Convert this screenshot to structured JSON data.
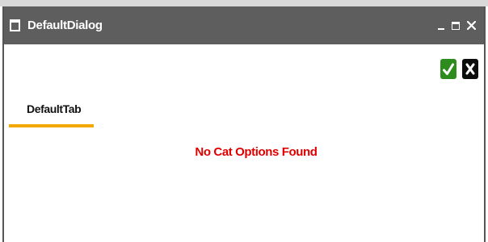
{
  "window": {
    "title": "DefaultDialog",
    "icons": {
      "window": "window-icon",
      "minimize": "minimize-icon",
      "maximize": "maximize-icon",
      "close": "close-icon"
    }
  },
  "actions": {
    "ok_icon": "checkmark-icon",
    "cancel_icon": "x-icon"
  },
  "tabs": [
    {
      "label": "DefaultTab",
      "active": true
    }
  ],
  "content": {
    "empty_message": "No Cat Options Found"
  },
  "colors": {
    "titlebar": "#5e5e5e",
    "tab_active_underline": "#f2a800",
    "empty_message": "#e00000",
    "ok_button": "#2e8b1e",
    "cancel_button": "#0d0d0d"
  }
}
